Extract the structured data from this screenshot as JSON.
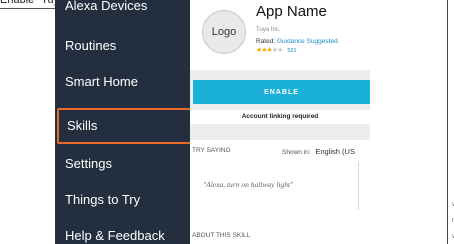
{
  "caption": "Enable \"Tuya Smart\" Skill",
  "sidebar": {
    "items": [
      {
        "label": "Alexa Devices"
      },
      {
        "label": "Routines"
      },
      {
        "label": "Smart Home"
      },
      {
        "label": "Skills"
      },
      {
        "label": "Settings"
      },
      {
        "label": "Things to Try"
      },
      {
        "label": "Help & Feedback"
      }
    ],
    "highlight_color": "#e86a25",
    "background": "#232f3e"
  },
  "skill": {
    "logo_label": "Logo",
    "app_name": "App Name",
    "developer": "Tuya Inc.",
    "rated_prefix": "Rated:",
    "rating_guidance": "Guidance Suggested",
    "stars_filled": 3,
    "stars_total": 5,
    "rating_count": "521",
    "enable_label": "ENABLE",
    "linking_note": "Account linking required",
    "try_saying": "TRY SAYING",
    "shown_in": "Shown in:",
    "language": "English (US",
    "utterance": "\"Alexa, turn on hallway light\"",
    "about": "ABOUT THIS SKILL",
    "accent_color": "#1ab0d8"
  },
  "right_edge_chars": [
    "v",
    "r",
    "v"
  ]
}
